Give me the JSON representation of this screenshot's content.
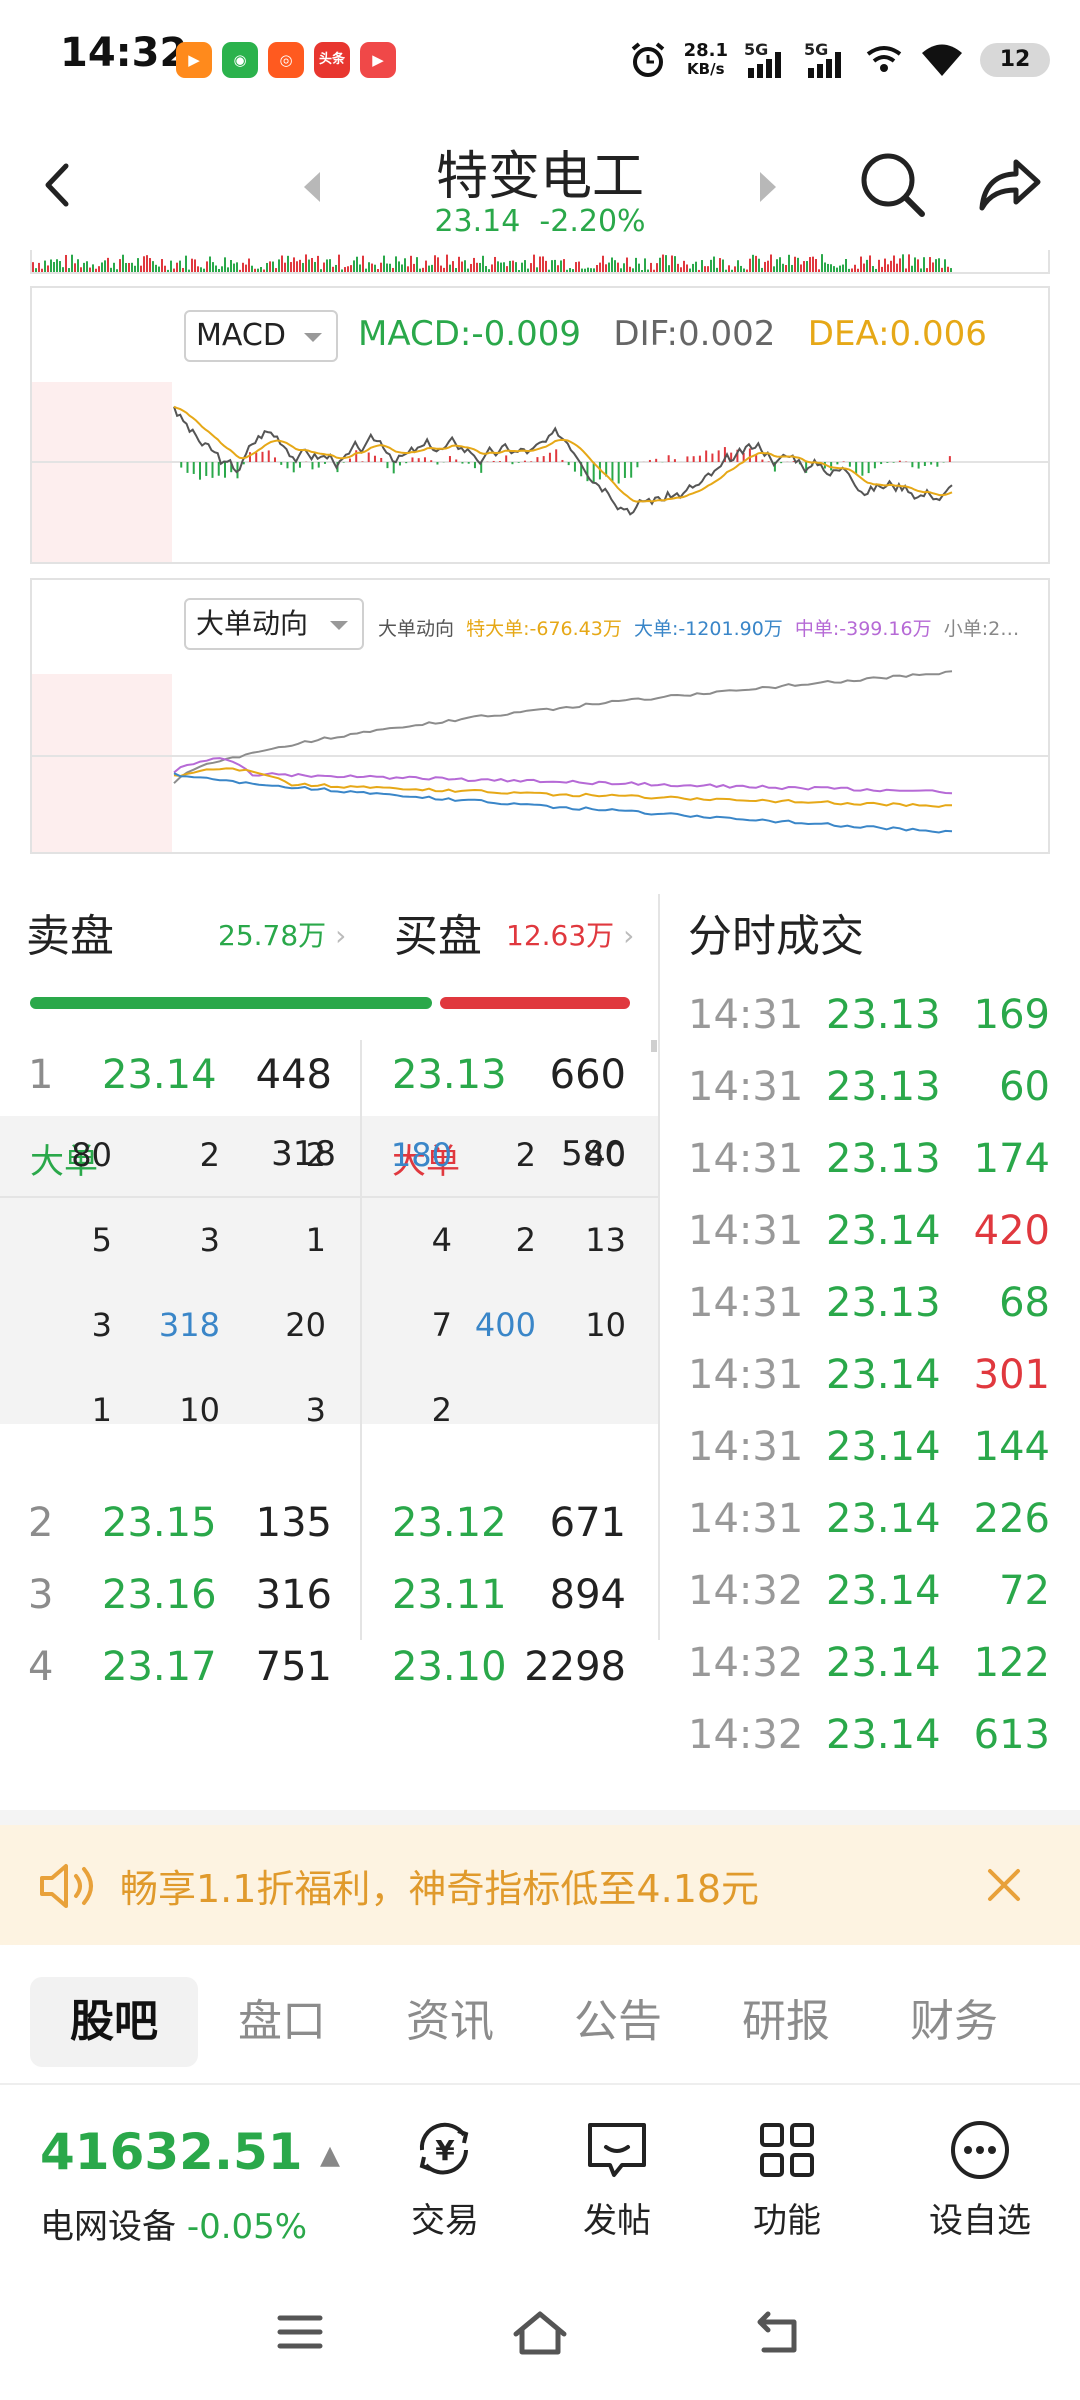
{
  "status": {
    "time": "14:32",
    "app_icons": [
      {
        "name": "video-app-icon",
        "color": "#ff8a1c",
        "glyph": "▶"
      },
      {
        "name": "wechat-icon",
        "color": "#2bb24c",
        "glyph": "◉"
      },
      {
        "name": "kuaishou-icon",
        "color": "#ff5a1f",
        "glyph": "◎"
      },
      {
        "name": "toutiao-icon",
        "color": "#e8362f",
        "glyph": "头条"
      },
      {
        "name": "video-player-icon",
        "color": "#f04848",
        "glyph": "▶"
      }
    ],
    "net_speed_value": "28.1",
    "net_speed_unit": "KB/s",
    "signal1": "5G",
    "signal2": "5G",
    "battery": "12"
  },
  "header": {
    "stock_name": "特变电工",
    "price": "23.14",
    "change": "-2.20%"
  },
  "macd": {
    "selector": "MACD",
    "macd": "MACD:-0.009",
    "dif": "DIF:0.002",
    "dea": "DEA:0.006"
  },
  "flow": {
    "selector": "大单动向",
    "label": "大单动向",
    "super_large": "特大单:-676.43万",
    "large": "大单:-1201.90万",
    "medium": "中单:-399.16万",
    "small": "小单:2…"
  },
  "book": {
    "sell_title": "卖盘",
    "sell_total": "25.78万",
    "buy_title": "买盘",
    "buy_total": "12.63万",
    "sell_ratio": 0.67,
    "level1": {
      "num": "1",
      "ask": "23.14",
      "ask_vol": "448",
      "bid": "23.13",
      "bid_vol": "660"
    },
    "big_label": "大单",
    "sell_big_total": "318",
    "buy_big_total": "580",
    "sell_big_rows": [
      [
        "80",
        "2",
        "2"
      ],
      [
        "5",
        "3",
        "1"
      ],
      [
        "3",
        "318",
        "20"
      ],
      [
        "1",
        "10",
        "3"
      ]
    ],
    "buy_big_rows": [
      [
        "180",
        "2",
        "40"
      ],
      [
        "4",
        "2",
        "13"
      ],
      [
        "7",
        "400",
        "10"
      ],
      [
        "2",
        "",
        ""
      ]
    ],
    "levels": [
      {
        "num": "2",
        "ask": "23.15",
        "ask_vol": "135",
        "bid": "23.12",
        "bid_vol": "671"
      },
      {
        "num": "3",
        "ask": "23.16",
        "ask_vol": "316",
        "bid": "23.11",
        "bid_vol": "894"
      },
      {
        "num": "4",
        "ask": "23.17",
        "ask_vol": "751",
        "bid": "23.10",
        "bid_vol": "2298"
      }
    ]
  },
  "trades": {
    "title": "分时成交",
    "rows": [
      {
        "time": "14:31",
        "price": "23.13",
        "vol": "169",
        "side": "green"
      },
      {
        "time": "14:31",
        "price": "23.13",
        "vol": "60",
        "side": "green"
      },
      {
        "time": "14:31",
        "price": "23.13",
        "vol": "174",
        "side": "green"
      },
      {
        "time": "14:31",
        "price": "23.14",
        "vol": "420",
        "side": "red"
      },
      {
        "time": "14:31",
        "price": "23.13",
        "vol": "68",
        "side": "green"
      },
      {
        "time": "14:31",
        "price": "23.14",
        "vol": "301",
        "side": "red"
      },
      {
        "time": "14:31",
        "price": "23.14",
        "vol": "144",
        "side": "green"
      },
      {
        "time": "14:31",
        "price": "23.14",
        "vol": "226",
        "side": "green"
      },
      {
        "time": "14:32",
        "price": "23.14",
        "vol": "72",
        "side": "green"
      },
      {
        "time": "14:32",
        "price": "23.14",
        "vol": "122",
        "side": "green"
      },
      {
        "time": "14:32",
        "price": "23.14",
        "vol": "613",
        "side": "green"
      }
    ]
  },
  "ad": {
    "text": "畅享1.1折福利，神奇指标低至4.18元"
  },
  "tabs": [
    "股吧",
    "盘口",
    "资讯",
    "公告",
    "研报",
    "财务"
  ],
  "bottom": {
    "index_value": "41632.51",
    "sector_name": "电网设备",
    "sector_change": "-0.05%",
    "actions": [
      {
        "name": "trade",
        "label": "交易"
      },
      {
        "name": "post",
        "label": "发帖"
      },
      {
        "name": "functions",
        "label": "功能"
      },
      {
        "name": "watchlist",
        "label": "设自选"
      }
    ]
  },
  "colors": {
    "up": "#e0383e",
    "down": "#2aa84a",
    "dea": "#e6a817",
    "large_order": "#3a86c8",
    "medium_order": "#b66ad6"
  }
}
